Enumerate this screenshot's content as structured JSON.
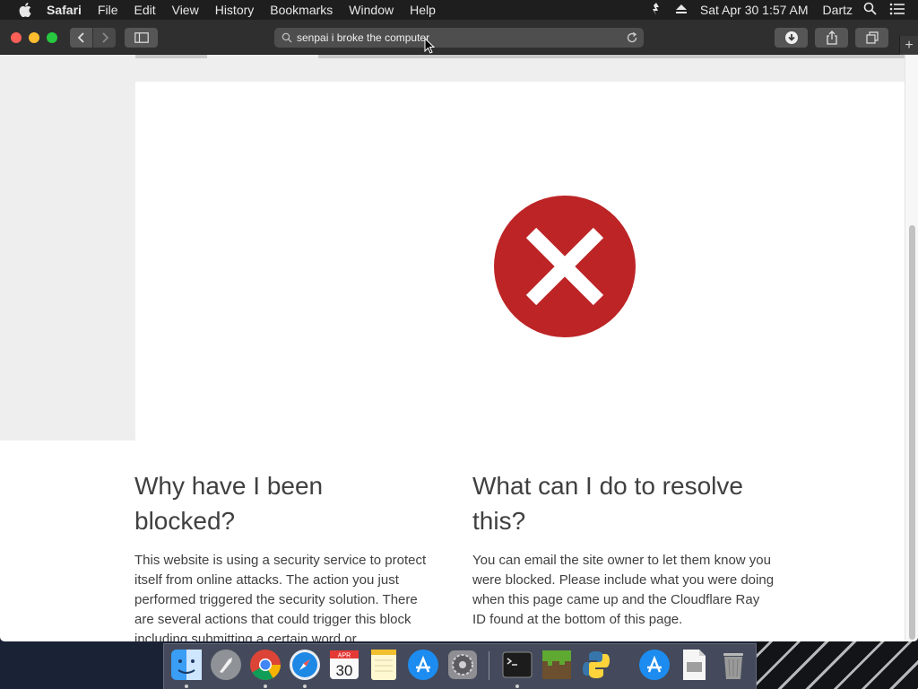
{
  "menubar": {
    "app_name": "Safari",
    "items": [
      "File",
      "Edit",
      "View",
      "History",
      "Bookmarks",
      "Window",
      "Help"
    ],
    "clock": "Sat Apr 30  1:57 AM",
    "user": "Dartz"
  },
  "toolbar": {
    "address": "senpai i broke the computer"
  },
  "page": {
    "left_heading": "Why have I been blocked?",
    "left_body": "This website is using a security service to protect itself from online attacks. The action you just performed triggered the security solution. There are several actions that could trigger this block including submitting a certain word or",
    "right_heading": "What can I do to resolve this?",
    "right_body": "You can email the site owner to let them know you were blocked. Please include what you were doing when this page came up and the Cloudflare Ray ID found at the bottom of this page.",
    "error_color": "#bd2426"
  },
  "dock": {
    "calendar_month": "APR",
    "calendar_day": "30",
    "items": [
      "finder-icon",
      "launchpad-icon",
      "chrome-icon",
      "safari-icon",
      "calendar-icon",
      "notes-icon",
      "app-store-icon",
      "system-preferences-icon",
      "terminal-icon",
      "minecraft-icon",
      "python-launcher-icon",
      "app-store-download-icon",
      "document-icon",
      "trash-icon"
    ]
  }
}
